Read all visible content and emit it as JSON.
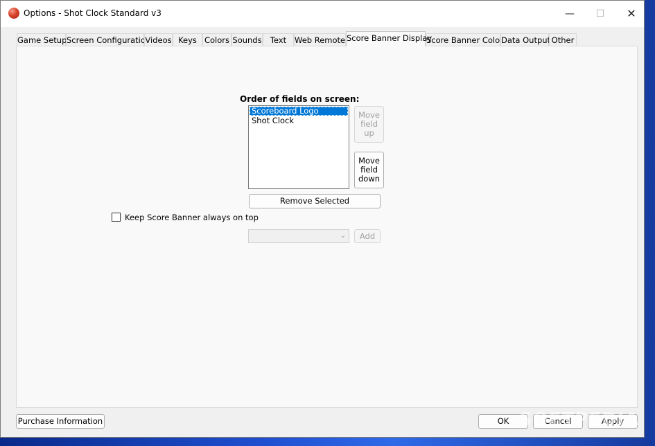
{
  "window": {
    "title": "Options - Shot Clock Standard v3"
  },
  "window_controls": {
    "minimize": "—",
    "maximize": "☐",
    "close": "✕"
  },
  "tabs": [
    {
      "label": "Game Setup"
    },
    {
      "label": "Screen Configuration"
    },
    {
      "label": "Videos"
    },
    {
      "label": "Keys"
    },
    {
      "label": "Colors"
    },
    {
      "label": "Sounds"
    },
    {
      "label": "Text"
    },
    {
      "label": "Web Remote"
    },
    {
      "label": "Score Banner Display",
      "active": true
    },
    {
      "label": "Score Banner Colors"
    },
    {
      "label": "Data Output"
    },
    {
      "label": "Other"
    }
  ],
  "main": {
    "heading": "Order of fields on screen:",
    "fields": [
      {
        "label": "Scoreboard Logo",
        "selected": true
      },
      {
        "label": "Shot Clock",
        "selected": false
      }
    ],
    "move_up": [
      "Move",
      "field",
      "up"
    ],
    "move_down": [
      "Move",
      "field",
      "down"
    ],
    "remove_selected": "Remove Selected",
    "keep_on_top": {
      "label": "Keep Score Banner always on top",
      "checked": false
    },
    "add_select": {
      "value": ""
    },
    "add_button": "Add"
  },
  "footer": {
    "purchase_info": "Purchase Information",
    "ok": "OK",
    "cancel": "Cancel",
    "apply": "Apply"
  },
  "watermark": "SOFTPEDIA"
}
